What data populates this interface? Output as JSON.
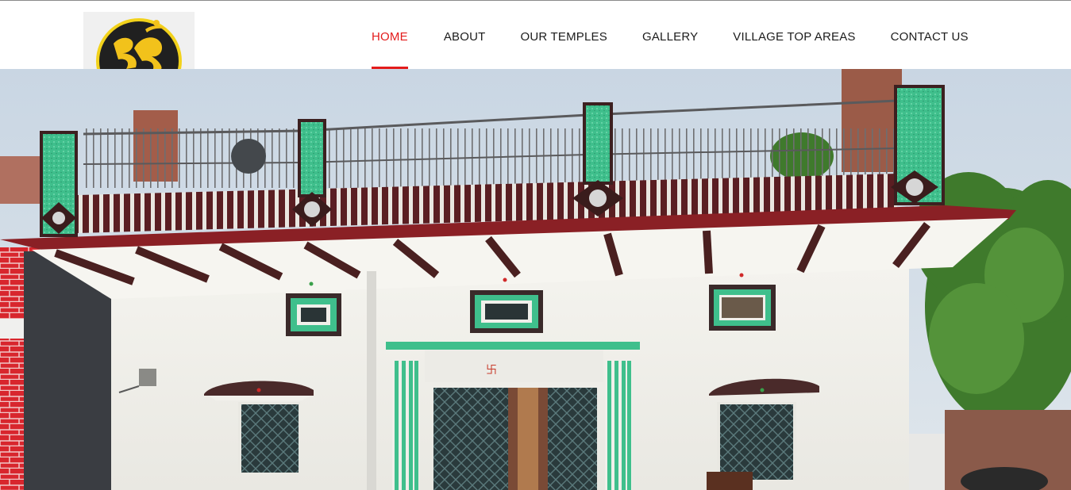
{
  "header": {
    "logo": {
      "icon": "om-icon",
      "colors": {
        "ring": "#f2d21b",
        "disc": "#202020",
        "glyph": "#f2c21b"
      }
    },
    "nav": {
      "items": [
        {
          "label": "HOME",
          "active": true
        },
        {
          "label": "ABOUT",
          "active": false
        },
        {
          "label": "OUR TEMPLES",
          "active": false
        },
        {
          "label": "GALLERY",
          "active": false
        },
        {
          "label": "VILLAGE TOP AREAS",
          "active": false
        },
        {
          "label": "CONTACT US",
          "active": false
        }
      ],
      "active_color": "#e31b1b",
      "text_color": "#1c1c1c"
    }
  },
  "hero": {
    "image": "village-house-photo"
  }
}
